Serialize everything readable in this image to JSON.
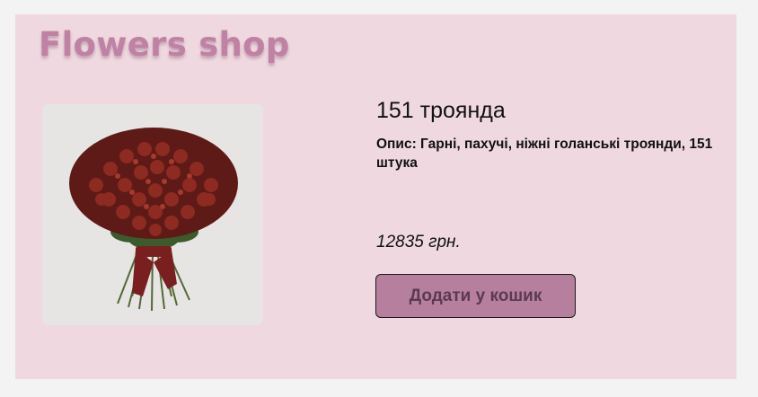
{
  "header": {
    "shop_title": "Flowers shop"
  },
  "product": {
    "name": "151 троянда",
    "description": "Опис: Гарні, пахучі, ніжні голанські троянди, 151 штука",
    "price": "12835 грн.",
    "add_to_cart_label": "Додати у кошик"
  },
  "colors": {
    "page_background": "#f3f3f3",
    "card_background": "#efd8df",
    "brand_title": "#c082a4",
    "button_background": "#b77f9e",
    "button_text": "#5a3a50"
  }
}
